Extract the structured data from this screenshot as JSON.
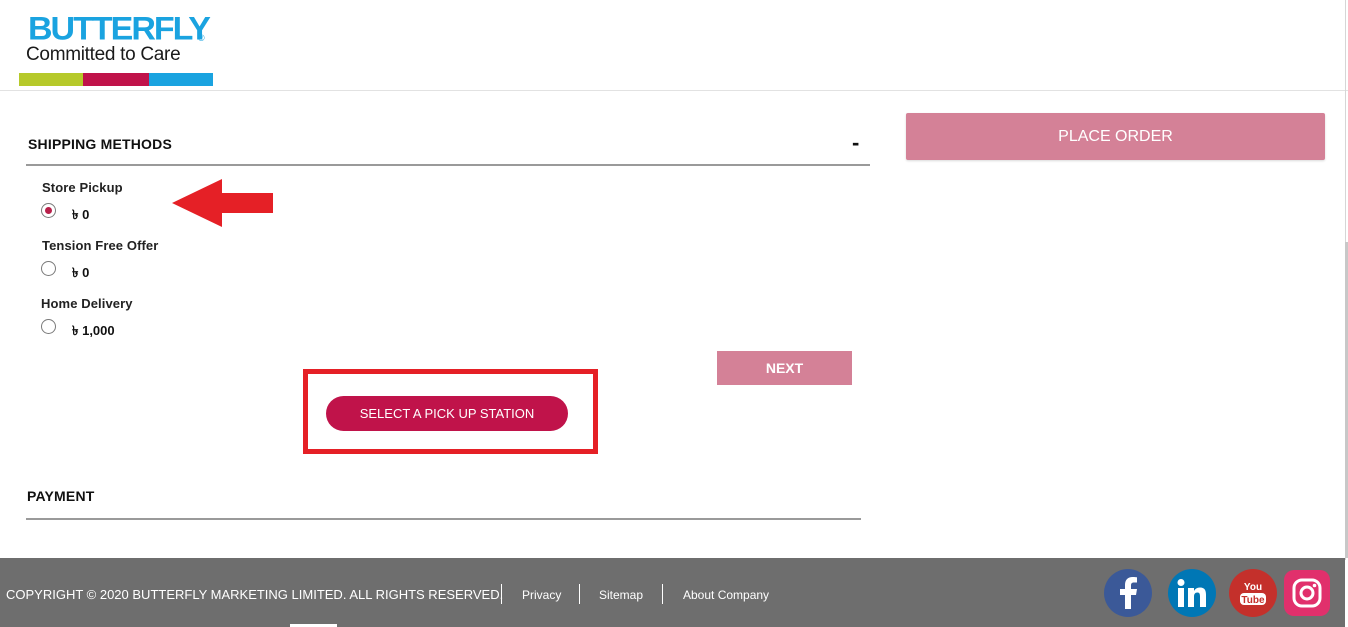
{
  "brand": {
    "name": "BUTTERFLY",
    "registered_mark": "®",
    "tagline": "Committed to Care",
    "bar_colors": [
      "#b6c92a",
      "#c0134a",
      "#1aa3e0"
    ]
  },
  "shipping": {
    "title": "SHIPPING METHODS",
    "toggle": "-",
    "methods": [
      {
        "label": "Store Pickup",
        "price": "৳ 0",
        "selected": true
      },
      {
        "label": "Tension Free Offer",
        "price": "৳ 0",
        "selected": false
      },
      {
        "label": "Home Delivery",
        "price": "৳ 1,000",
        "selected": false
      }
    ],
    "next_label": "NEXT",
    "pickup_label": "SELECT A PICK UP STATION"
  },
  "payment": {
    "title": "PAYMENT"
  },
  "order": {
    "place_order_label": "PLACE ORDER"
  },
  "footer": {
    "copyright": "COPYRIGHT © 2020 BUTTERFLY MARKETING LIMITED. ALL RIGHTS RESERVED.",
    "links": [
      "Privacy",
      "Sitemap",
      "About Company"
    ],
    "social": [
      {
        "icon": "facebook-icon",
        "color": "#3b5998"
      },
      {
        "icon": "linkedin-icon",
        "color": "#0077b5"
      },
      {
        "icon": "youtube-icon",
        "color": "#c4302b"
      },
      {
        "icon": "instagram-icon",
        "color": "#e1306c"
      }
    ]
  },
  "colors": {
    "accent": "#c0134a",
    "button_muted": "#d48197",
    "annotation_red": "#e52026",
    "footer_bg": "#6e6e6e"
  }
}
